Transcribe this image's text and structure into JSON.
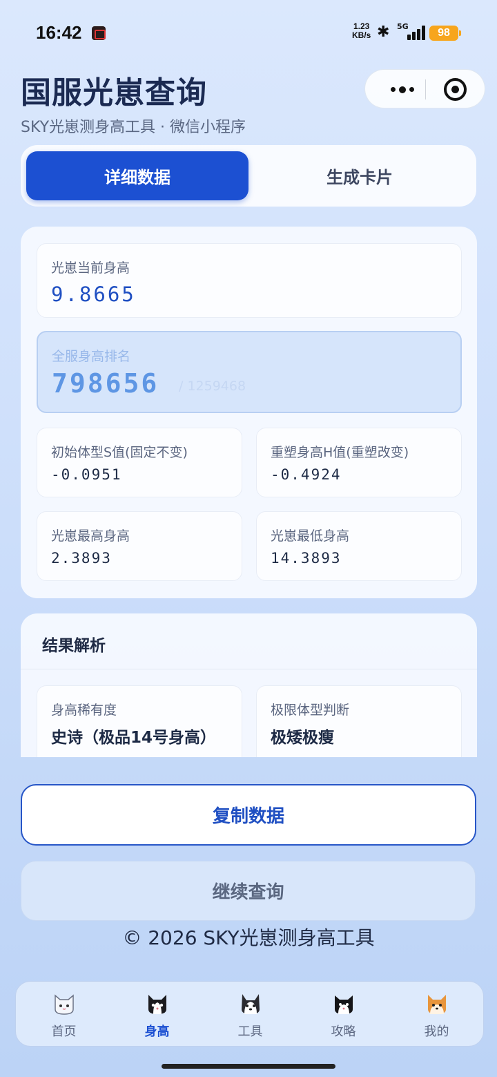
{
  "status_bar": {
    "time": "16:42",
    "net_speed_value": "1.23",
    "net_speed_unit": "KB/s",
    "network": "5G",
    "battery": "98"
  },
  "header": {
    "title": "国服光崽查询",
    "subtitle": "SKY光崽测身高工具 · 微信小程序"
  },
  "tabs": [
    {
      "label": "详细数据",
      "active": true
    },
    {
      "label": "生成卡片",
      "active": false
    }
  ],
  "data": {
    "current_height": {
      "label": "光崽当前身高",
      "value": "9.8665"
    },
    "rank": {
      "label": "全服身高排名",
      "value": "798656",
      "total": "/ 1259468"
    },
    "s_value": {
      "label": "初始体型S值(固定不变)",
      "value": "-0.0951"
    },
    "h_value": {
      "label": "重塑身高H值(重塑改变)",
      "value": "-0.4924"
    },
    "max_height": {
      "label": "光崽最高身高",
      "value": "2.3893"
    },
    "min_height": {
      "label": "光崽最低身高",
      "value": "14.3893"
    }
  },
  "analysis": {
    "title": "结果解析",
    "rarity": {
      "label": "身高稀有度",
      "value": "史诗（极品14号身高）"
    },
    "extreme": {
      "label": "极限体型判断",
      "value": "极矮极瘦"
    }
  },
  "buttons": {
    "copy": "复制数据",
    "continue": "继续查询"
  },
  "footer": "© 2026 SKY光崽测身高工具",
  "nav": [
    {
      "label": "首页",
      "icon": "white-cat-icon",
      "active": false
    },
    {
      "label": "身高",
      "icon": "black-white-cat-icon",
      "active": true
    },
    {
      "label": "工具",
      "icon": "husky-icon",
      "active": false
    },
    {
      "label": "攻略",
      "icon": "tuxedo-cat-icon",
      "active": false
    },
    {
      "label": "我的",
      "icon": "shiba-icon",
      "active": false
    }
  ],
  "colors": {
    "accent": "#1c50d2",
    "battery": "#f7a51c"
  }
}
